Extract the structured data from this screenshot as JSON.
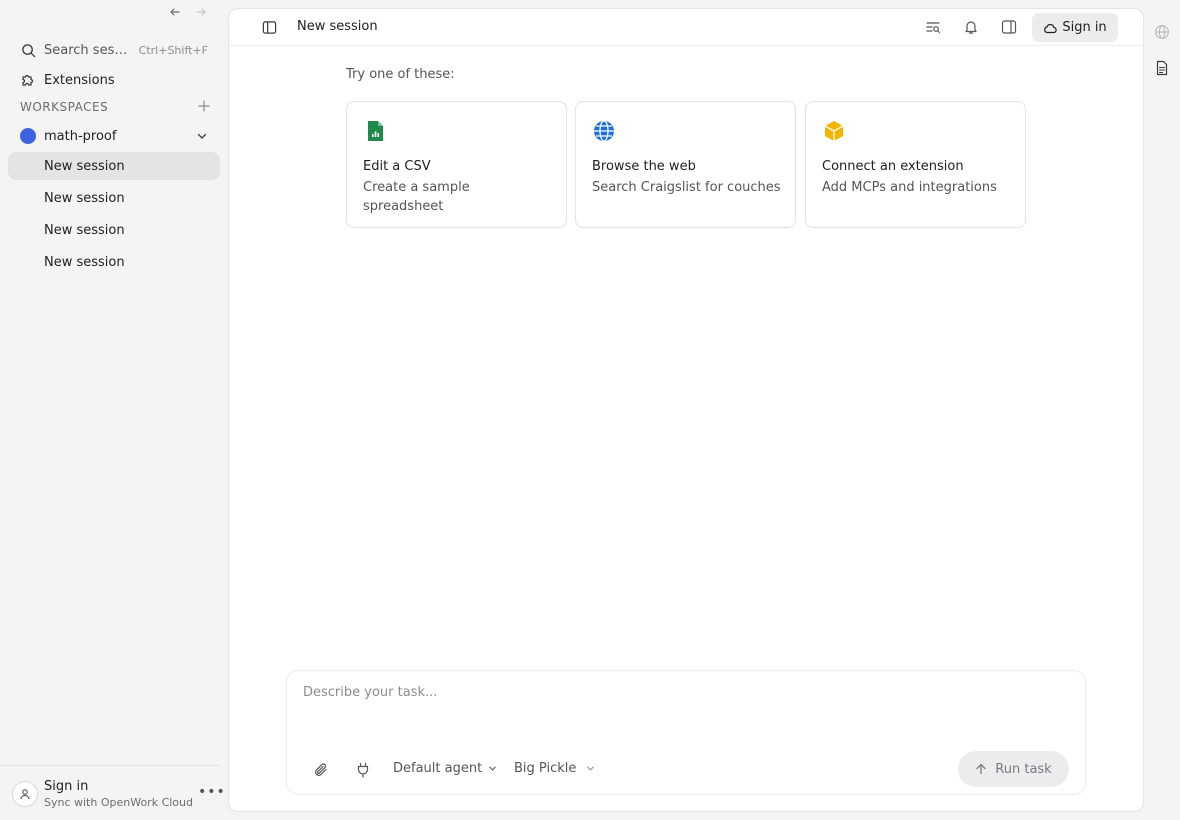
{
  "sidebar": {
    "search": {
      "label": "Search sessions",
      "shortcut": "Ctrl+Shift+F"
    },
    "extensions_label": "Extensions",
    "workspaces_label": "WORKSPACES",
    "workspace": {
      "name": "math-proof",
      "color": "#3b63e0"
    },
    "sessions": [
      {
        "label": "New session",
        "active": true
      },
      {
        "label": "New session",
        "active": false
      },
      {
        "label": "New session",
        "active": false
      },
      {
        "label": "New session",
        "active": false
      }
    ],
    "footer": {
      "title": "Sign in",
      "subtitle": "Sync with OpenWork Cloud"
    }
  },
  "topbar": {
    "title": "New session",
    "signin_label": "Sign in"
  },
  "main": {
    "try_label": "Try one of these:",
    "cards": [
      {
        "title": "Edit a CSV",
        "description": "Create a sample spreadsheet",
        "icon": "spreadsheet-icon",
        "color": "#1e8a4c"
      },
      {
        "title": "Browse the web",
        "description": "Search Craigslist for couches",
        "icon": "globe-icon",
        "color": "#1e6fd9"
      },
      {
        "title": "Connect an extension",
        "description": "Add MCPs and integrations",
        "icon": "cube-icon",
        "color": "#f5b400"
      }
    ]
  },
  "composer": {
    "placeholder": "Describe your task...",
    "agent_label": "Default agent",
    "model_label": "Big Pickle",
    "run_label": "Run task"
  }
}
